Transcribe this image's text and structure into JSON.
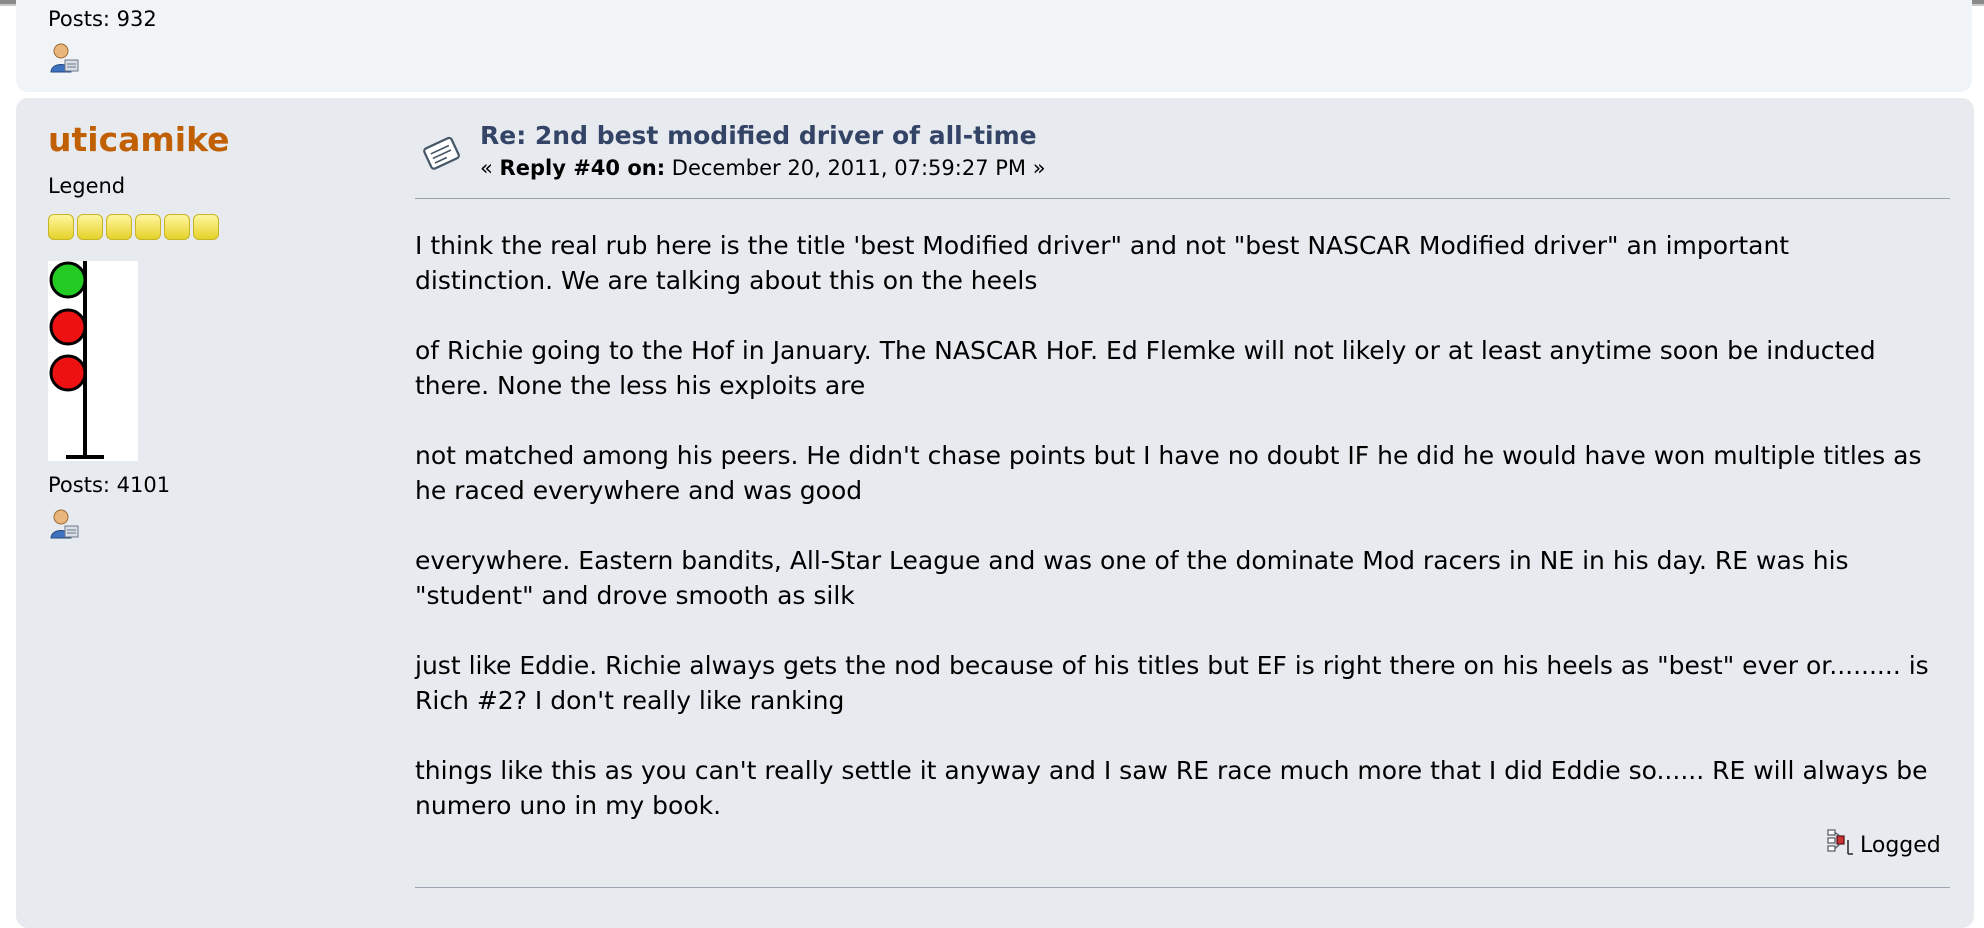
{
  "previous_post": {
    "posts_label": "Posts: 932",
    "profile_icon": "profile-icon"
  },
  "post": {
    "poster": {
      "name": "uticamike",
      "member_group": "Legend",
      "star_count": 6,
      "posts_label": "Posts: 4101",
      "avatar": "traffic-light-avatar",
      "profile_icon": "profile-icon"
    },
    "title": "Re: 2nd best modified driver of all-time",
    "meta": {
      "open": "«",
      "reply_label": "Reply #40 on:",
      "date": "December 20, 2011, 07:59:27 PM",
      "close": "»"
    },
    "body": [
      "I think the real rub here is the title 'best Modified driver\" and not \"best NASCAR Modified driver\" an important distinction. We are talking about this on the heels",
      "of Richie going to the Hof in January.  The NASCAR HoF. Ed Flemke will not likely or at least anytime soon be inducted there. None the less his exploits are",
      "not matched among his peers. He didn't chase points but I have no doubt IF he did he would have won multiple titles as he raced everywhere and was good",
      "everywhere. Eastern bandits, All-Star League and was one of the dominate Mod racers in NE in his day. RE was his \"student\" and drove smooth as silk",
      "just like Eddie. Richie always gets the nod because of his titles but EF is right there on his heels as \"best\" ever or......... is Rich #2?   I don't really like ranking",
      "things like this as you can't really settle it anyway and I saw RE race much more that I did Eddie so...... RE will always be numero uno in my book."
    ],
    "logged_label": "Logged",
    "logged_icon": "logged-ip-icon"
  },
  "colors": {
    "poster_name": "#c06002",
    "title": "#334466",
    "post_bg": "#e7eaef",
    "prev_post_bg": "#f0f4f7"
  }
}
